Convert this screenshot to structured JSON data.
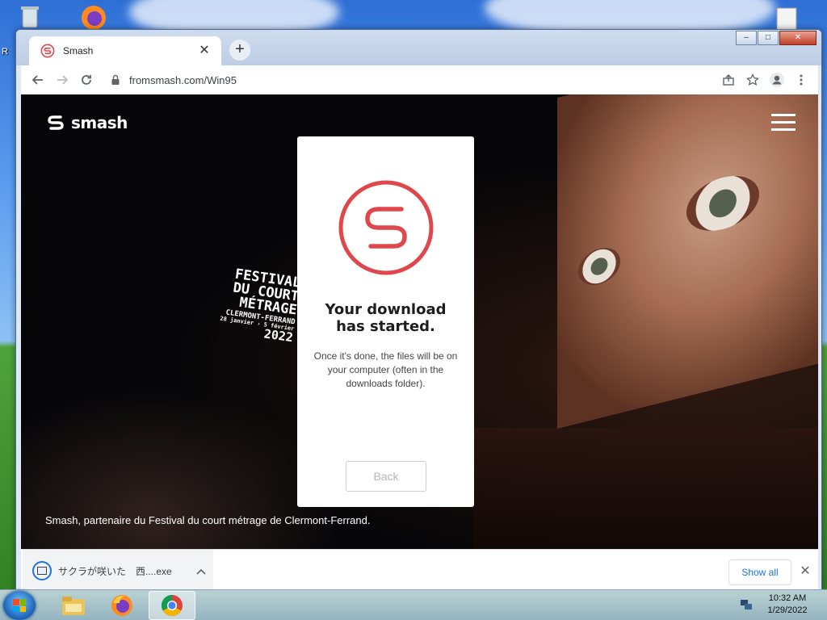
{
  "desktop": {
    "left_label": "R"
  },
  "browser": {
    "tab": {
      "title": "Smash",
      "favicon": "smash-logo-icon"
    },
    "new_tab_symbol": "+",
    "window_controls": {
      "minimize": "–",
      "maximize": "□",
      "close": "✕"
    },
    "toolbar": {
      "url": "fromsmash.com/Win95",
      "icons": [
        "back-arrow-icon",
        "forward-arrow-icon",
        "reload-icon",
        "lock-icon",
        "share-icon",
        "star-icon",
        "profile-icon",
        "more-vert-icon"
      ]
    }
  },
  "page": {
    "brand_name": "smash",
    "festival": {
      "line1": "FESTIVAL",
      "line2": "DU COURT",
      "line3": "MÉTRAGE",
      "line4": "CLERMONT-FERRAND",
      "line5": "28 janvier › 5 février",
      "line6": "2022"
    },
    "dialog": {
      "title": "Your download has started.",
      "body": "Once it's done, the files will be on your computer (often in the downloads folder).",
      "back_label": "Back"
    },
    "caption": "Smash, partenaire du Festival du court métrage de Clermont-Ferrand."
  },
  "downloads_bar": {
    "file_name": "サクラが咲いた　西....exe",
    "show_all_label": "Show all",
    "close_symbol": "✕"
  },
  "taskbar": {
    "apps": [
      "windows-explorer-icon",
      "firefox-icon",
      "chrome-icon"
    ],
    "active_app": "chrome-icon",
    "clock_time": "10:32 AM",
    "clock_date": "1/29/2022"
  },
  "colors": {
    "smash_red": "#e0474c",
    "chrome_blue": "#1a73e8"
  }
}
